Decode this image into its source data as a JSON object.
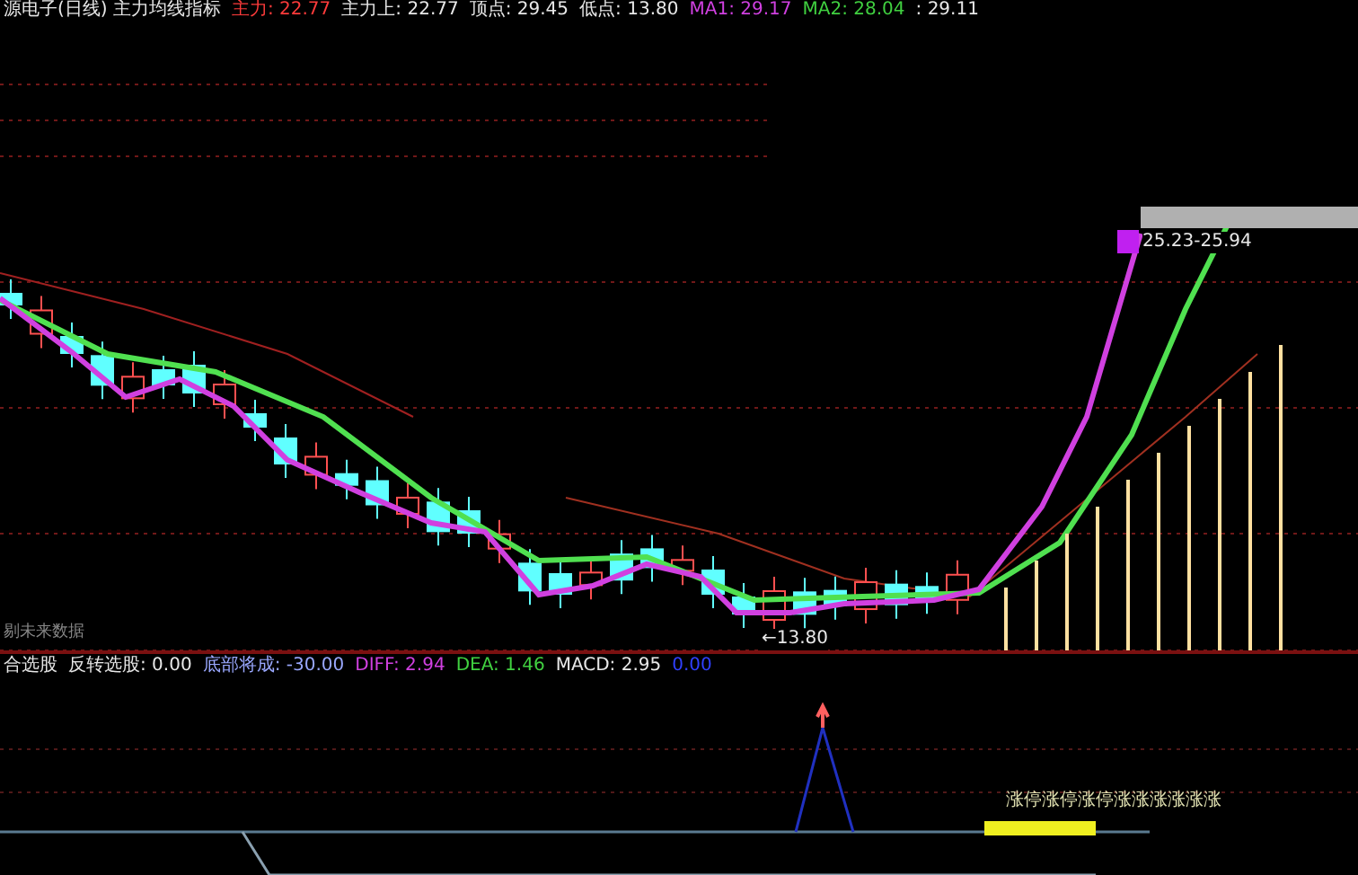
{
  "header": {
    "title": "源电子(日线) 主力均线指标",
    "indicators": [
      {
        "text": "主力: 22.77",
        "color": "#ff3b3b"
      },
      {
        "text": "主力上: 22.77",
        "color": "#e8e8e8"
      },
      {
        "text": "顶点: 29.45",
        "color": "#e8e8e8"
      },
      {
        "text": "低点: 13.80",
        "color": "#e8e8e8"
      },
      {
        "text": "MA1: 29.17",
        "color": "#d040e0"
      },
      {
        "text": "MA2: 28.04",
        "color": "#40d040"
      },
      {
        "text": ": 29.11",
        "color": "#e8e8e8"
      }
    ]
  },
  "main_chart": {
    "range_label": "25.23-25.94",
    "low_label": "←13.80",
    "footnote": "剔未来数据"
  },
  "sub_header": {
    "title": "合选股",
    "indicators": [
      {
        "text": "反转选股: 0.00",
        "color": "#e8e8e8"
      },
      {
        "text": "底部将成: -30.00",
        "color": "#9aa8ff"
      },
      {
        "text": "DIFF: 2.94",
        "color": "#d040e0"
      },
      {
        "text": "DEA: 1.46",
        "color": "#40d040"
      },
      {
        "text": "MACD: 2.95",
        "color": "#e8e8e8"
      },
      {
        "text": "0.00",
        "color": "#3040ff"
      }
    ]
  },
  "sub_chart": {
    "signal_text": "涨停涨停涨停涨涨涨涨涨涨"
  }
}
